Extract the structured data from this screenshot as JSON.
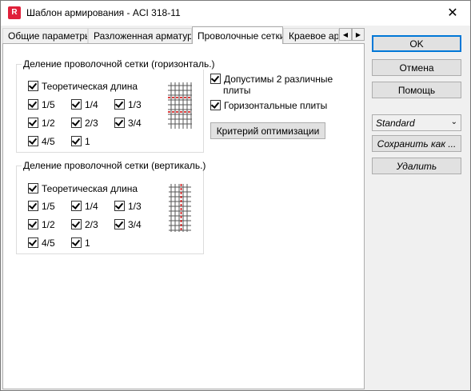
{
  "window": {
    "title": "Шаблон армирования - ACI 318-11",
    "app_icon": "R"
  },
  "tabs": [
    {
      "label": "Общие параметры",
      "active": false
    },
    {
      "label": "Разложенная арматура",
      "active": false
    },
    {
      "label": "Проволочные сетки",
      "active": true
    },
    {
      "label": "Краевое арм",
      "active": false
    }
  ],
  "horizontal_group": {
    "title": "Деление проволочной сетки (горизонталь.)",
    "theoretical": {
      "label": "Теоретическая длина",
      "checked": true
    },
    "fractions": [
      {
        "label": "1/5",
        "checked": true
      },
      {
        "label": "1/4",
        "checked": true
      },
      {
        "label": "1/3",
        "checked": true
      },
      {
        "label": "1/2",
        "checked": true
      },
      {
        "label": "2/3",
        "checked": true
      },
      {
        "label": "3/4",
        "checked": true
      },
      {
        "label": "4/5",
        "checked": true
      },
      {
        "label": "1",
        "checked": true
      }
    ]
  },
  "vertical_group": {
    "title": "Деление проволочной сетки (вертикаль.)",
    "theoretical": {
      "label": "Теоретическая длина",
      "checked": true
    },
    "fractions": [
      {
        "label": "1/5",
        "checked": true
      },
      {
        "label": "1/4",
        "checked": true
      },
      {
        "label": "1/3",
        "checked": true
      },
      {
        "label": "1/2",
        "checked": true
      },
      {
        "label": "2/3",
        "checked": true
      },
      {
        "label": "3/4",
        "checked": true
      },
      {
        "label": "4/5",
        "checked": true
      },
      {
        "label": "1",
        "checked": true
      }
    ]
  },
  "options": {
    "two_plates": {
      "label_line1": "Допустимы 2 различные",
      "label_line2": "плиты",
      "checked": true
    },
    "horizontal_plates": {
      "label": "Горизонтальные плиты",
      "checked": true
    },
    "optimization_button": "Критерий оптимизации"
  },
  "side_buttons": {
    "ok": "OK",
    "cancel": "Отмена",
    "help": "Помощь",
    "template_select": "Standard",
    "save_as": "Сохранить как ...",
    "delete": "Удалить"
  },
  "colors": {
    "accent": "#0078d7",
    "app_icon": "#e0203a",
    "grid_cut": "#d00000"
  }
}
